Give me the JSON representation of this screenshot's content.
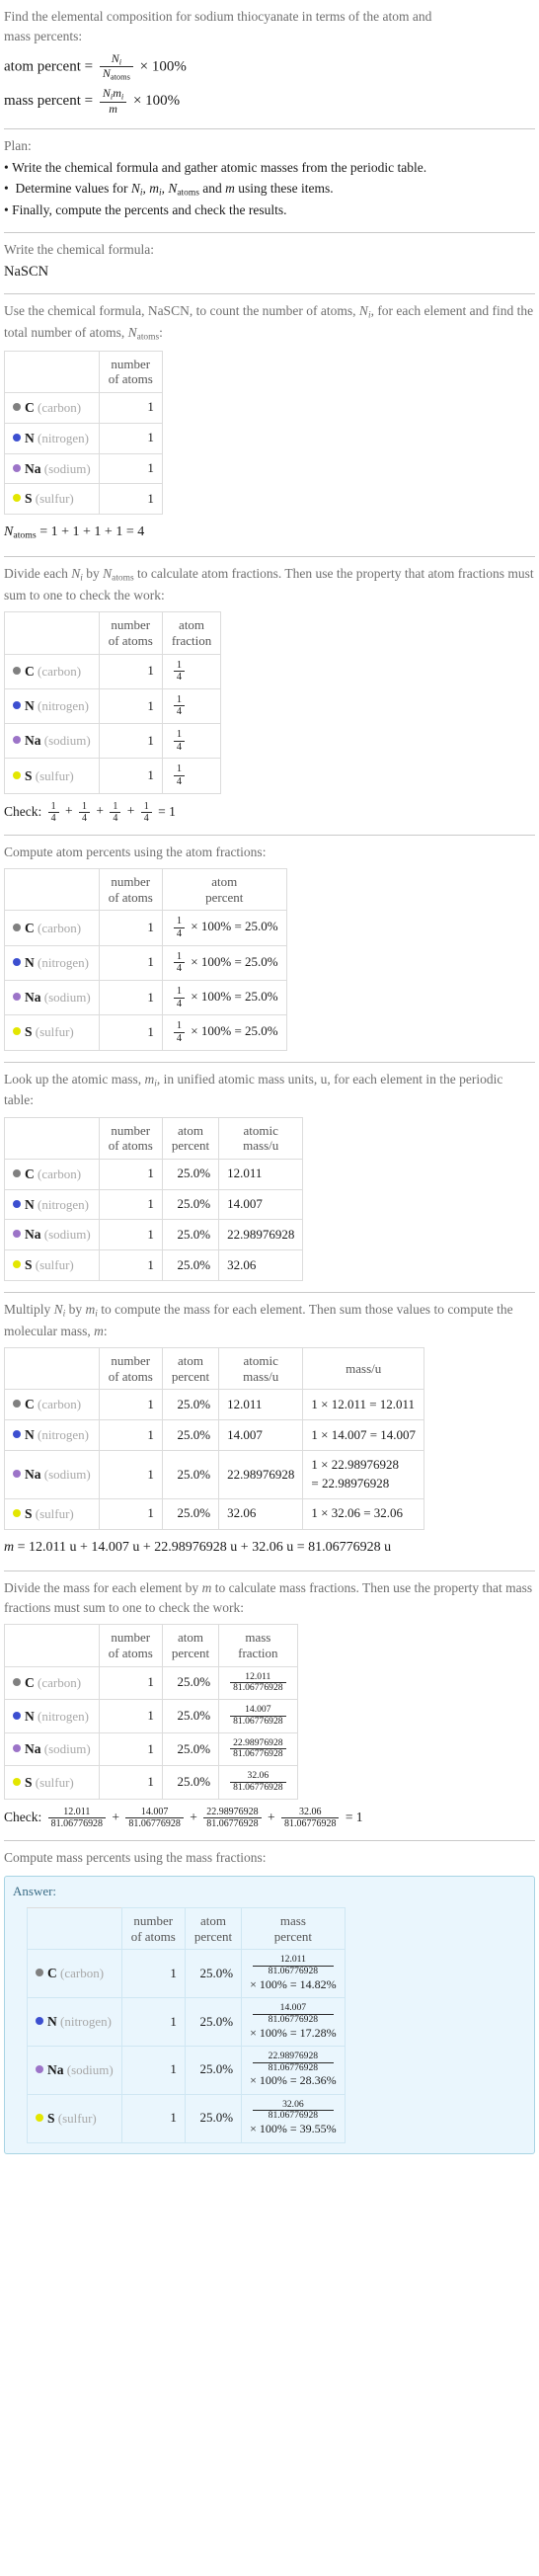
{
  "question": {
    "line1": "Find the elemental composition for sodium thiocyanate in terms of the atom and",
    "line2": "mass percents:",
    "atom_percent_label": "atom percent =",
    "mass_percent_label": "mass percent =",
    "times_100": "× 100%",
    "Ni": "N",
    "i": "i",
    "Natoms_base": "N",
    "atoms_sub": "atoms",
    "m": "m",
    "mi": "m"
  },
  "plan": {
    "label": "Plan:",
    "items": [
      "Write the chemical formula and gather atomic masses from the periodic table.",
      "Determine values for Nᵢ, mᵢ, Nₐₜₒₘₛ and m using these items.",
      "Finally, compute the percents and check the results."
    ],
    "item2_parts": {
      "pre": "Determine values for ",
      "mid": " and ",
      "post": " using these items."
    }
  },
  "formula_section": {
    "prompt": "Write the chemical formula:",
    "formula": "NaSCN"
  },
  "count_section": {
    "prompt_line1": "Use the chemical formula, NaSCN, to count the number of atoms, Nᵢ, for each",
    "prompt_line2": "element and find the total number of atoms, Nₐₜₒₘₛ:",
    "prompt_pre": "Use the chemical formula, NaSCN, to count the number of atoms, ",
    "prompt_mid": ", for each element and find the total number of atoms, ",
    "prompt_post": ":",
    "headers": [
      "",
      "number of atoms"
    ],
    "header_num_line1": "number",
    "header_num_line2": "of atoms",
    "total_line": "Nₐₜₒₘₛ = 1 + 1 + 1 + 1 = 4",
    "total_expr": "= 1 + 1 + 1 + 1 = 4"
  },
  "elements": [
    {
      "symbol": "C",
      "name": "(carbon)",
      "color": "#808080",
      "count": "1",
      "atom_fraction_num": "1",
      "atom_fraction_den": "4",
      "atom_percent": "25.0%",
      "atomic_mass": "12.011",
      "mass_calc": "1 × 12.011 = 12.011",
      "mass_frac_num": "12.011",
      "mass_frac_den": "81.06776928",
      "mass_percent": "× 100% = 14.82%"
    },
    {
      "symbol": "N",
      "name": "(nitrogen)",
      "color": "#3c4fd0",
      "count": "1",
      "atom_fraction_num": "1",
      "atom_fraction_den": "4",
      "atom_percent": "25.0%",
      "atomic_mass": "14.007",
      "mass_calc": "1 × 14.007 = 14.007",
      "mass_frac_num": "14.007",
      "mass_frac_den": "81.06776928",
      "mass_percent": "× 100% = 17.28%"
    },
    {
      "symbol": "Na",
      "name": "(sodium)",
      "color": "#9c74c8",
      "count": "1",
      "atom_fraction_num": "1",
      "atom_fraction_den": "4",
      "atom_percent": "25.0%",
      "atomic_mass": "22.98976928",
      "mass_calc": "1 × 22.98976928 = 22.98976928",
      "mass_calc_line1": "1 × 22.98976928",
      "mass_calc_line2": "= 22.98976928",
      "mass_frac_num": "22.98976928",
      "mass_frac_den": "81.06776928",
      "mass_percent": "× 100% = 28.36%"
    },
    {
      "symbol": "S",
      "name": "(sulfur)",
      "color": "#e3e600",
      "count": "1",
      "atom_fraction_num": "1",
      "atom_fraction_den": "4",
      "atom_percent": "25.0%",
      "atomic_mass": "32.06",
      "mass_calc": "1 × 32.06 = 32.06",
      "mass_frac_num": "32.06",
      "mass_frac_den": "81.06776928",
      "mass_percent": "× 100% = 39.55%"
    }
  ],
  "atom_fraction_section": {
    "prompt_line1": "Divide each Nᵢ by Nₐₜₒₘₛ to calculate atom fractions. Then use the property that",
    "prompt_line2": "atom fractions must sum to one to check the work:",
    "prompt_pre": "Divide each ",
    "prompt_mid": " by ",
    "prompt_post": " to calculate atom fractions. Then use the property that atom fractions must sum to one to check the work:",
    "header_frac_line1": "atom",
    "header_frac_line2": "fraction",
    "check_label": "Check:",
    "check_result": "= 1"
  },
  "atom_percent_section": {
    "prompt": "Compute atom percents using the atom fractions:",
    "header_pct_line1": "atom",
    "header_pct_line2": "percent",
    "times_100_eq": "× 100% = 25.0%"
  },
  "atomic_mass_section": {
    "prompt_line1": "Look up the atomic mass, mᵢ, in unified atomic mass units, u, for each element in",
    "prompt_line2": "the periodic table:",
    "prompt_pre": "Look up the atomic mass, ",
    "prompt_post": ", in unified atomic mass units, u, for each element in the periodic table:",
    "header_mass_line1": "atomic",
    "header_mass_line2": "mass/u"
  },
  "molecular_mass_section": {
    "prompt_line1": "Multiply Nᵢ by mᵢ to compute the mass for each element. Then sum those values",
    "prompt_line2": "to compute the molecular mass, m:",
    "prompt_pre": "Multiply ",
    "prompt_mid": " by ",
    "prompt_mid2": " to compute the mass for each element. Then sum those values to compute the molecular mass, ",
    "prompt_post": ":",
    "header_mass_u": "mass/u",
    "total_line": "m = 12.011 u + 14.007 u + 22.98976928 u + 32.06 u = 81.06776928 u",
    "total_expr": "= 12.011 u + 14.007 u + 22.98976928 u + 32.06 u = 81.06776928 u"
  },
  "mass_fraction_section": {
    "prompt_line1": "Divide the mass for each element by m to calculate mass fractions. Then use the",
    "prompt_line2": "property that mass fractions must sum to one to check the work:",
    "prompt_pre": "Divide the mass for each element by ",
    "prompt_post": " to calculate mass fractions. Then use the property that mass fractions must sum to one to check the work:",
    "header_frac_line1": "mass",
    "header_frac_line2": "fraction",
    "check_label": "Check:",
    "check_result": "= 1"
  },
  "answer_section": {
    "prompt": "Compute mass percents using the mass fractions:",
    "answer_label": "Answer:",
    "header_num_line1": "number",
    "header_num_line2": "of atoms",
    "header_pct_line1": "atom",
    "header_pct_line2": "percent",
    "header_mass_pct_line1": "mass",
    "header_mass_pct_line2": "percent"
  }
}
